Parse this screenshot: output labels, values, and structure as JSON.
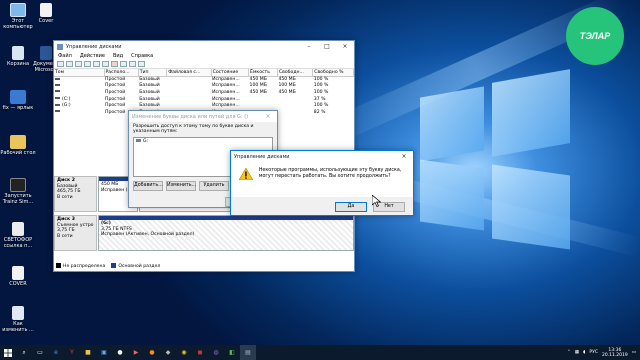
{
  "desktop": {
    "icons": [
      {
        "label": "Этот компьютер",
        "icon": "computer-icon"
      },
      {
        "label": "Cover",
        "icon": "document-icon"
      },
      {
        "label": "Корзина",
        "icon": "recycle-bin-icon"
      },
      {
        "label": "Документ Microsoft",
        "icon": "word-document-icon"
      },
      {
        "label": "fix — ярлык",
        "icon": "shortcut-icon"
      },
      {
        "label": "Рабочий стол",
        "icon": "folder-icon"
      },
      {
        "label": "Запустить Trainz Sim...",
        "icon": "game-icon"
      },
      {
        "label": "СВЕТОФОР ссылка п...",
        "icon": "traffic-light-icon"
      },
      {
        "label": "COVER",
        "icon": "document-icon"
      },
      {
        "label": "Как изменить ...",
        "icon": "document-icon"
      }
    ],
    "logo_text": "ТЭЛАР"
  },
  "window": {
    "title": "Управление дисками",
    "menu": [
      "Файл",
      "Действие",
      "Вид",
      "Справка"
    ],
    "columns": [
      "Том",
      "Располо...",
      "Тип",
      "Файловая с...",
      "Состояние",
      "Ёмкость",
      "Свободн...",
      "Свободно %"
    ],
    "rows": [
      [
        "",
        "Простой",
        "Базовый",
        "",
        "Исправен...",
        "450 МБ",
        "450 МБ",
        "100 %"
      ],
      [
        "",
        "Простой",
        "Базовый",
        "",
        "Исправен...",
        "100 МБ",
        "100 МБ",
        "100 %"
      ],
      [
        "",
        "Простой",
        "Базовый",
        "",
        "Исправен...",
        "450 МБ",
        "450 МБ",
        "100 %"
      ],
      [
        "(C:)",
        "Простой",
        "Базовый",
        "",
        "Исправен...",
        "",
        "",
        "37 %"
      ],
      [
        "(G:)",
        "Простой",
        "Базовый",
        "",
        "Исправен...",
        "",
        "",
        "100 %"
      ],
      [
        "",
        "Простой",
        "Базовый",
        "",
        "Исправен...",
        "",
        "",
        "82 %"
      ]
    ],
    "disks": [
      {
        "label": "Диск 2",
        "type": "Базовый",
        "size": "465,75 ГБ",
        "state": "В сети",
        "part": {
          "name": "",
          "size": "450 МБ",
          "state": "Исправен (Р..."
        }
      },
      {
        "label": "Диск 3",
        "type": "Съемное устро",
        "size": "3,75 ГБ",
        "state": "В сети",
        "part": {
          "name": "(G:)",
          "size": "3,75 ГБ NTFS",
          "state": "Исправен (Активен, Основной раздел)"
        }
      }
    ],
    "legend": [
      "Не распределена",
      "Основной раздел"
    ]
  },
  "change_letter_dialog": {
    "title": "Изменение буквы диска или путей для G: ()",
    "instruction": "Разрешить доступ к этому тому по букве диска и указанным путям:",
    "list_item": "G:",
    "add_button": "Добавить...",
    "change_button": "Изменить...",
    "remove_button": "Удалить",
    "ok_button": "ОК"
  },
  "confirm_dialog": {
    "title": "Управление дисками",
    "message": "Некоторые программы, использующие эту букву диска, могут перестать работать. Вы хотите продолжить?",
    "yes_button": "Да",
    "no_button": "Нет"
  },
  "taskbar": {
    "lang": "РУС",
    "time": "13:36",
    "date": "20.11.2019"
  },
  "colors": {
    "accent": "#0078d7",
    "primary_partition": "#1f3d8c",
    "unallocated": "#000000",
    "logo": "#25c47a"
  }
}
